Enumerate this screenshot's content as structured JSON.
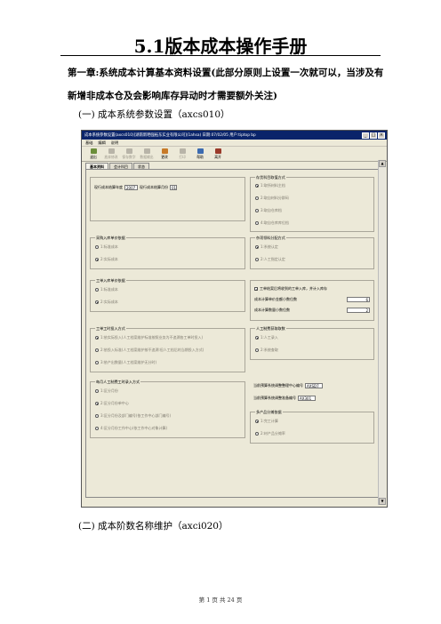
{
  "doc": {
    "title": "5.1版本成本操作手册",
    "chapter": "第一章:系统成本计算基本资料设置(此部分原则上设置一次就可以，当涉及有新增非成本仓及会影响库存异动时才需要额外关注)",
    "section1": "(一)   成本系统参数设置（axcs010）",
    "section2": "(二)   成本阶数名称维护（axci020）",
    "page_footer": "第 1 页 共 24 页"
  },
  "app": {
    "window_title": "成本系统参数设置(axcs010)[湖南新晒强拓东实业有限公司](1ahsa)  日期:07/02/05  用户:tiptop bp",
    "menu": [
      "基础",
      "编辑",
      "说明"
    ],
    "toolbar": [
      {
        "label": "退出",
        "icon": "exit-icon",
        "color": "#6b8e3a",
        "enabled": true
      },
      {
        "label": "放弃修改",
        "icon": "undo-icon",
        "color": "#b8b4a8",
        "enabled": false
      },
      {
        "label": "保存数字",
        "icon": "save-icon",
        "color": "#b8b4a8",
        "enabled": false
      },
      {
        "label": "数据输出",
        "icon": "export-icon",
        "color": "#b8b4a8",
        "enabled": false
      },
      {
        "label": "更改",
        "icon": "edit-icon",
        "color": "#c77a28",
        "enabled": true
      },
      {
        "label": "打印",
        "icon": "print-icon",
        "color": "#b8b4a8",
        "enabled": false
      },
      {
        "label": "帮助",
        "icon": "help-icon",
        "color": "#3c6bb0",
        "enabled": true
      },
      {
        "label": "离开",
        "icon": "leave-icon",
        "color": "#9a3a2a",
        "enabled": true
      }
    ],
    "tabs": [
      "基本资料",
      "会计科目",
      "状态"
    ],
    "year_label": "现行成本结算年度",
    "year_value": "2007",
    "month_label": "现行成本结算月份",
    "month_value": "01",
    "cost_account": {
      "legend": "存货科目取值方式",
      "options": [
        "1:取所材料主档",
        "2:取自材料分群码",
        "3:取自仓库档",
        "4:取自仓库库位档"
      ]
    },
    "purchase_in": {
      "legend": "采购入库单价依据",
      "options": [
        "1:标准成本",
        "2:实际成本"
      ]
    },
    "overhead_alloc": {
      "legend": "杂项领料分配方式",
      "options": [
        "1:系统认定",
        "2:人工指定认定"
      ]
    },
    "work_in": {
      "legend": "工单入库单价依据",
      "options": [
        "1:标准成本",
        "2:实际成本"
      ]
    },
    "checkbox_label": "工单结案后将收到的工单入库，并计入库存",
    "decimals": [
      {
        "label": "成本计算单价金额小数位数",
        "value": "6"
      },
      {
        "label": "成本计算数量小数位数",
        "value": "2"
      }
    ],
    "work_method": {
      "legend": "工单工时投入方式",
      "options": [
        "1:依实际投入(人工档案维护标准按照业务为不追溯各工单时投入)",
        "2:依投入标准(人工档案维护按不追溯:但人工档后的当期投入方式)",
        "3:依产出数量(人工档案维护无分时)"
      ]
    },
    "labor_hours": {
      "legend": "人工制费获取取数",
      "options": [
        "1:人工录入",
        "2:系统查取"
      ]
    },
    "labor_group": {
      "legend": "每月人工制费工时录入方式",
      "options": [
        "1:区分月份",
        "2:区分月份单中心",
        "3:区分月份及部门编号(依工作中心部门编号)",
        "4:区分月份工作中心(依工作中心对象计算)"
      ]
    },
    "post_code": [
      {
        "label": "当前预算系统调整整理中心编号",
        "value": "AXSD7"
      },
      {
        "label": "当前预算系统调整准备编号",
        "value": "AX301"
      }
    ],
    "multi_product": {
      "legend": "多产品分摊依据",
      "options": [
        "1:完工计算",
        "2:材产品分摊率"
      ]
    }
  }
}
